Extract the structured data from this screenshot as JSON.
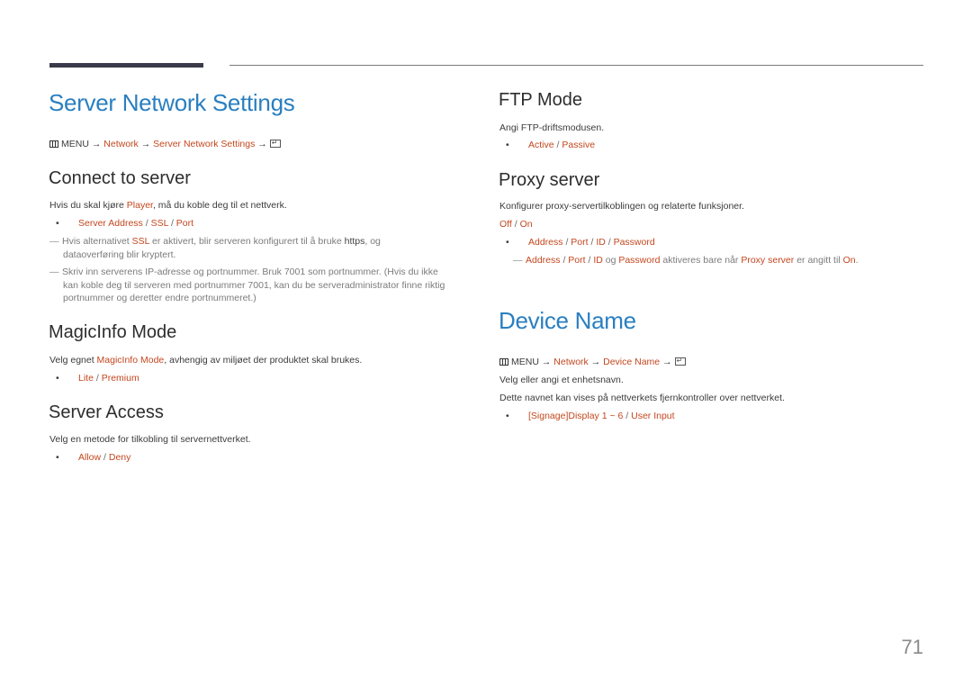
{
  "header": {},
  "left": {
    "title": "Server Network Settings",
    "breadcrumb": {
      "menu": "MENU",
      "arrow": "→",
      "items": [
        "Network",
        "Server Network Settings"
      ]
    },
    "connect": {
      "heading": "Connect to server",
      "desc_pre": "Hvis du skal kjøre ",
      "desc_hl": "Player",
      "desc_post": ", må du koble deg til et nettverk.",
      "options": [
        "Server Address",
        "SSL",
        "Port"
      ],
      "note1_pre": "Hvis alternativet ",
      "note1_hl": "SSL",
      "note1_mid": " er aktivert, blir serveren konfigurert til å bruke ",
      "note1_bold": "https",
      "note1_post": ", og",
      "note1_line2": "dataoverføring blir kryptert.",
      "note2_line1": "Skriv inn serverens IP-adresse og portnummer. Bruk 7001 som portnummer. (Hvis du ikke",
      "note2_line2": "kan koble deg til serveren med portnummer 7001, kan du be serveradministrator finne riktig",
      "note2_line3": "portnummer og deretter endre portnummeret.)"
    },
    "magicinfo": {
      "heading": "MagicInfo Mode",
      "desc_pre": "Velg egnet ",
      "desc_hl": "MagicInfo Mode",
      "desc_post": ", avhengig av miljøet der produktet skal brukes.",
      "options": [
        "Lite",
        "Premium"
      ]
    },
    "access": {
      "heading": "Server Access",
      "desc": "Velg en metode for tilkobling til servernettverket.",
      "options": [
        "Allow",
        "Deny"
      ]
    }
  },
  "right": {
    "ftp": {
      "heading": "FTP Mode",
      "desc": "Angi FTP-driftsmodusen.",
      "options": [
        "Active",
        "Passive"
      ]
    },
    "proxy": {
      "heading": "Proxy server",
      "desc": "Konfigurer proxy-servertilkoblingen og relaterte funksjoner.",
      "toggle": [
        "Off",
        "On"
      ],
      "options": [
        "Address",
        "Port",
        "ID",
        "Password"
      ],
      "note_og": " og ",
      "note_mid": " aktiveres bare når ",
      "note_hl": "Proxy server",
      "note_mid2": " er angitt til ",
      "note_on": "On",
      "note_end": "."
    },
    "device": {
      "title": "Device Name",
      "breadcrumb": {
        "menu": "MENU",
        "arrow": "→",
        "items": [
          "Network",
          "Device Name"
        ]
      },
      "desc1": "Velg eller angi et enhetsnavn.",
      "desc2": "Dette navnet kan vises på nettverkets fjernkontroller over nettverket.",
      "options": [
        "[Signage]Display 1 ~ 6",
        "User Input"
      ]
    }
  },
  "footer": {
    "page_number": "71"
  },
  "colors": {
    "title_blue": "#2a7fc0",
    "highlight": "#c4471f"
  }
}
